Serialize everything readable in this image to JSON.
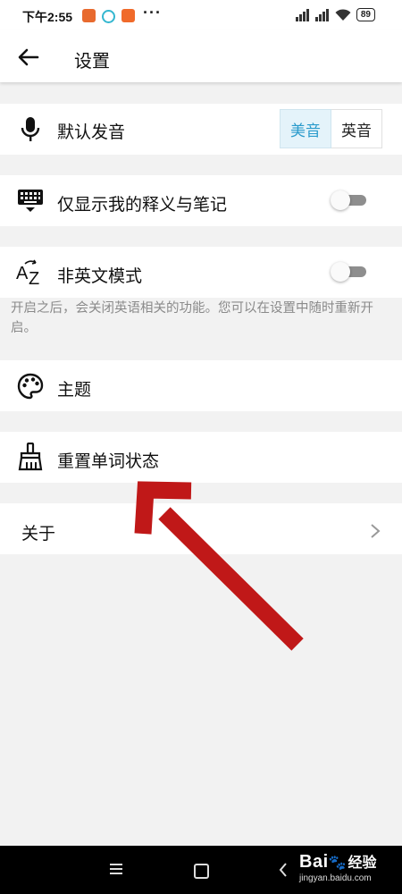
{
  "status_bar": {
    "time": "下午2:55",
    "app_icons": [
      "app-icon-orange",
      "app-icon-cyan",
      "app-icon-mi"
    ],
    "more": "···",
    "battery": "89",
    "colors": {
      "orange": "#e86a2e",
      "cyan": "#35b7d0",
      "mi": "#f06a2a"
    }
  },
  "app_bar": {
    "title": "设置"
  },
  "settings": {
    "pronunciation": {
      "label": "默认发音",
      "options": [
        "美音",
        "英音"
      ],
      "selected": "美音"
    },
    "notes_only": {
      "label": "仅显示我的释义与笔记",
      "enabled": false
    },
    "non_english": {
      "label": "非英文模式",
      "enabled": false,
      "hint": "开启之后，会关闭英语相关的功能。您可以在设置中随时重新开启。"
    },
    "theme": {
      "label": "主题"
    },
    "reset": {
      "label": "重置单词状态"
    },
    "about": {
      "label": "关于"
    }
  },
  "accent_color": "#2a9bcc",
  "annotation_color": "#c01818",
  "nav_bar": {
    "buttons": [
      "menu-icon",
      "home-icon",
      "back-icon"
    ]
  },
  "watermark": {
    "logo": "Bai",
    "logo_suffix": "经验",
    "url": "jingyan.baidu.com"
  }
}
